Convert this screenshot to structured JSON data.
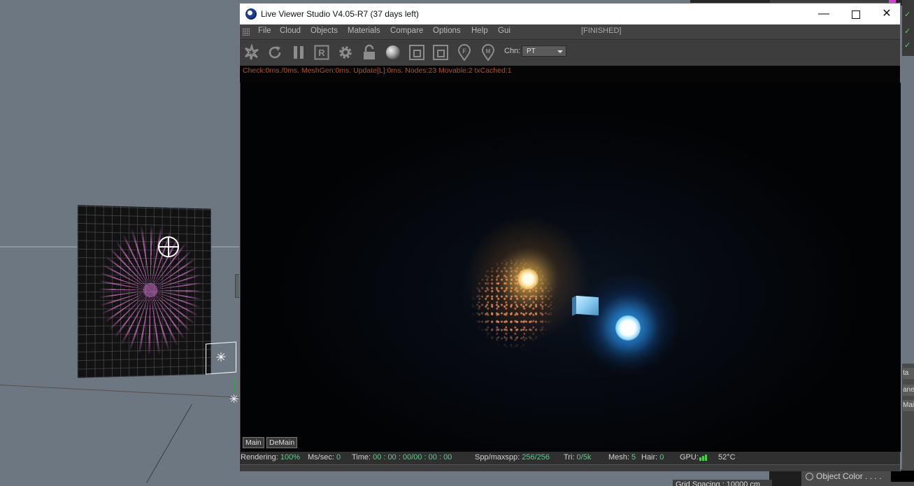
{
  "window": {
    "title": "Live Viewer Studio V4.05-R7 (37 days left)",
    "minimize": "—",
    "close": "✕"
  },
  "menu": {
    "items": [
      "File",
      "Cloud",
      "Objects",
      "Materials",
      "Compare",
      "Options",
      "Help",
      "Gui"
    ],
    "status": "[FINISHED]"
  },
  "toolbar": {
    "icons": [
      "send-scene-icon",
      "restart-icon",
      "pause-icon",
      "region-render-icon",
      "settings-gear-icon",
      "lock-icon",
      "material-ball-icon",
      "clay-mode-icon",
      "subsample-icon",
      "focus-pick-icon",
      "material-pick-icon"
    ],
    "channel_label": "Chn:",
    "channel_value": "PT"
  },
  "stats": {
    "line": "Check:0ms./0ms. MeshGen:0ms. Update[L]:0ms. Nodes:23 Movable:2 txCached:1"
  },
  "view_tabs": [
    "Main",
    "DeMain"
  ],
  "statusbar": {
    "rendering_label": "Rendering:",
    "rendering_value": "100%",
    "mssec_label": "Ms/sec:",
    "mssec_value": "0",
    "time_label": "Time:",
    "time_value": "00 : 00 : 00/00 : 00 : 00",
    "spp_label": "Spp/maxspp:",
    "spp_value": "256/256",
    "tri_label": "Tri:",
    "tri_value": "0/5k",
    "mesh_label": "Mesh:",
    "mesh_value": "5",
    "hair_label": "Hair:",
    "hair_value": "0",
    "gpu_label": "GPU:",
    "gpu_temp": "52°C"
  },
  "background_app": {
    "object_color_label": "Object Color . . . .",
    "grid_spacing": "Grid Spacing : 10000 cm",
    "side_tabs": [
      "ta",
      "ane",
      "Mai"
    ]
  },
  "colors": {
    "stats_text": "#b0502a",
    "status_value": "#5dc98a",
    "gpu_bar": "#4ecb4f"
  }
}
